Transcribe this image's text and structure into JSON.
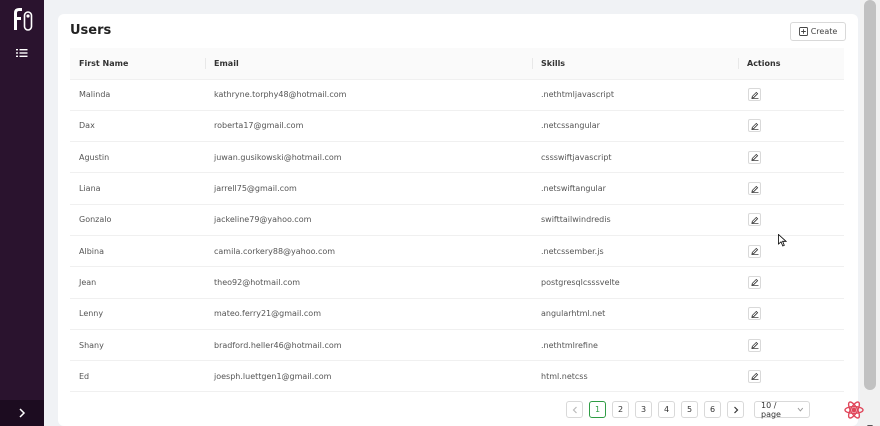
{
  "page": {
    "title": "Users",
    "create_label": "Create"
  },
  "table": {
    "columns": [
      "First Name",
      "Email",
      "Skills",
      "Actions"
    ],
    "rows": [
      {
        "first_name": "Malinda",
        "email": "kathryne.torphy48@hotmail.com",
        "skills": ".nethtmljavascript"
      },
      {
        "first_name": "Dax",
        "email": "roberta17@gmail.com",
        "skills": ".netcssangular"
      },
      {
        "first_name": "Agustin",
        "email": "juwan.gusikowski@hotmail.com",
        "skills": "cssswiftjavascript"
      },
      {
        "first_name": "Liana",
        "email": "jarrell75@gmail.com",
        "skills": ".netswiftangular"
      },
      {
        "first_name": "Gonzalo",
        "email": "jackeline79@yahoo.com",
        "skills": "swifttailwindredis"
      },
      {
        "first_name": "Albina",
        "email": "camila.corkery88@yahoo.com",
        "skills": ".netcssember.js"
      },
      {
        "first_name": "Jean",
        "email": "theo92@hotmail.com",
        "skills": "postgresqlcsssvelte"
      },
      {
        "first_name": "Lenny",
        "email": "mateo.ferry21@gmail.com",
        "skills": "angularhtml.net"
      },
      {
        "first_name": "Shany",
        "email": "bradford.heller46@hotmail.com",
        "skills": ".nethtmlrefine"
      },
      {
        "first_name": "Ed",
        "email": "joesph.luettgen1@gmail.com",
        "skills": "html.netcss"
      }
    ]
  },
  "pagination": {
    "pages": [
      "1",
      "2",
      "3",
      "4",
      "5",
      "6"
    ],
    "current": "1",
    "page_size": "10 / page"
  },
  "icons": {
    "logo": "refine-logo",
    "menu": "list-icon",
    "collapse": "chevron-right-icon",
    "create": "plus-square-icon",
    "edit": "edit-icon",
    "prev": "chevron-left-icon",
    "next": "chevron-right-icon",
    "page_size": "chevron-down-icon",
    "devtools": "react-icon"
  },
  "colors": {
    "sidebar": "#2a132e",
    "accent": "#2f9c44",
    "background": "#f0f2f5"
  }
}
